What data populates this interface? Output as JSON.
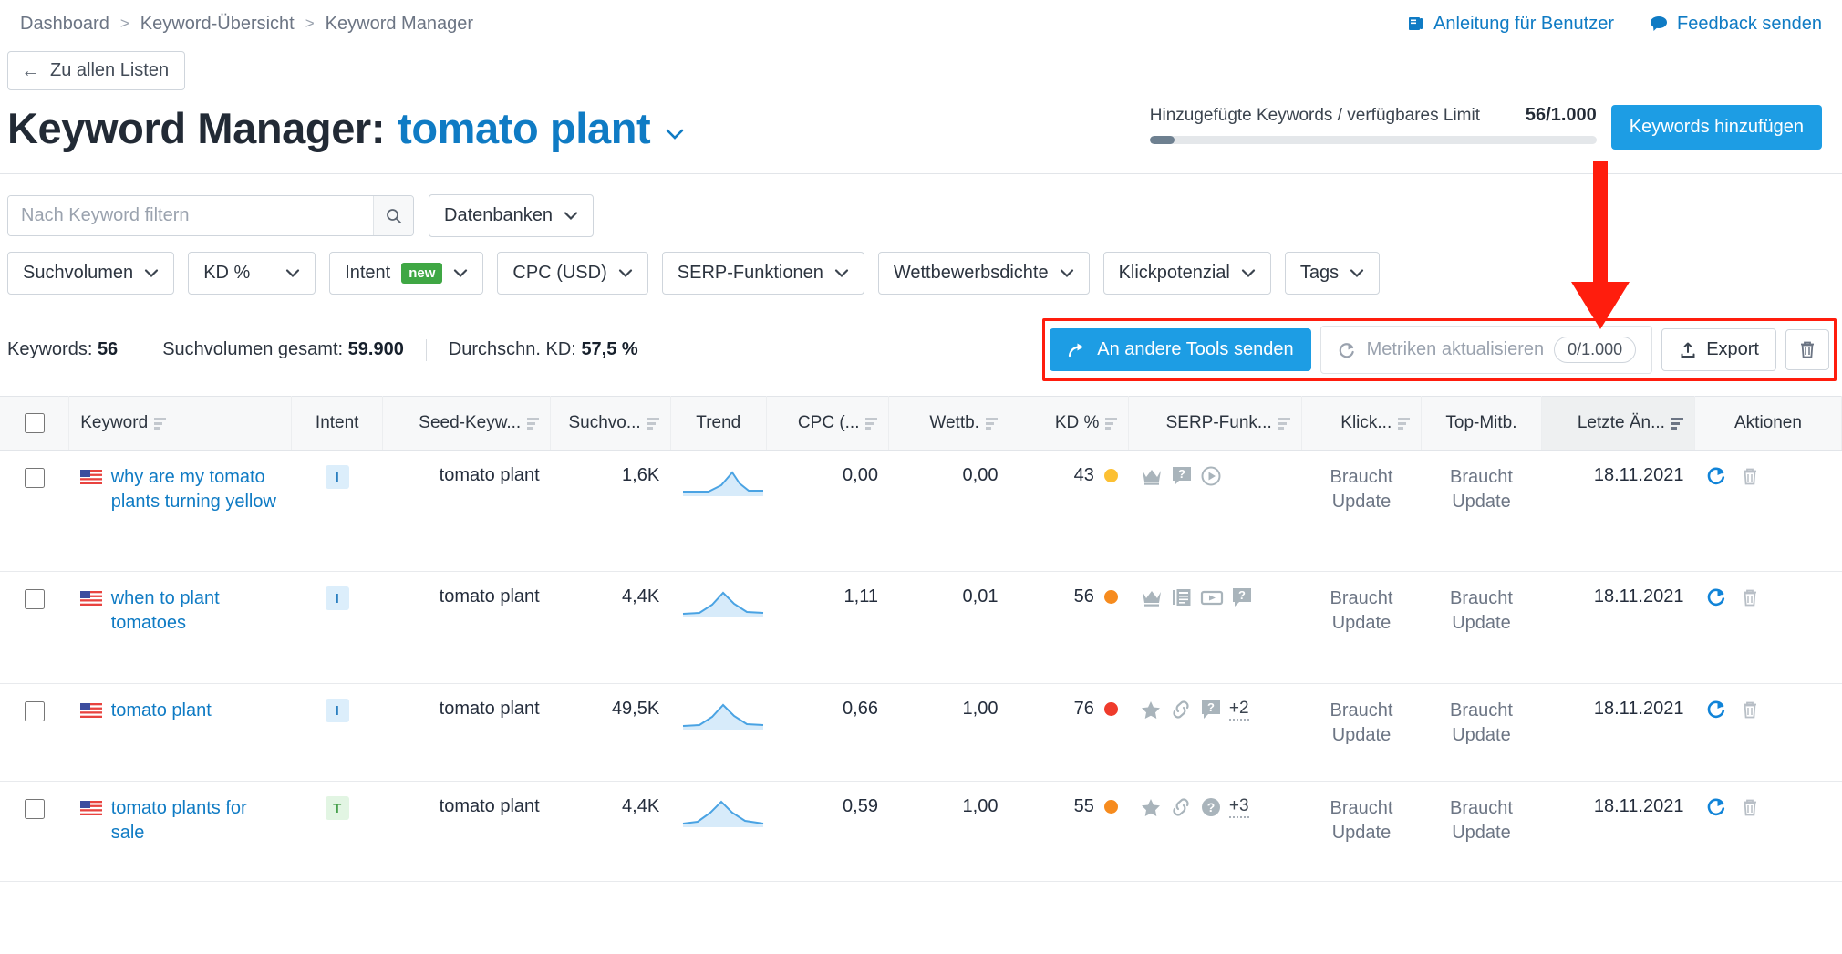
{
  "breadcrumb": {
    "items": [
      "Dashboard",
      "Keyword-Übersicht",
      "Keyword Manager"
    ],
    "separator": ">"
  },
  "toplinks": [
    {
      "label": "Anleitung für Benutzer",
      "icon": "book-icon"
    },
    {
      "label": "Feedback senden",
      "icon": "comment-icon"
    }
  ],
  "back_button": {
    "label": "Zu allen Listen",
    "icon": "arrow-left-icon"
  },
  "header": {
    "title_prefix": "Keyword Manager:",
    "keyword": "tomato plant",
    "caret": "⌄"
  },
  "limit": {
    "label": "Hinzugefügte Keywords / verfügbares Limit",
    "value": "56/1.000",
    "percent": 5.6,
    "add_button": "Keywords hinzufügen"
  },
  "filters": {
    "search": {
      "placeholder": "Nach Keyword filtern",
      "value": ""
    },
    "row1": [
      {
        "label": "Datenbanken"
      }
    ],
    "row2": [
      {
        "label": "Suchvolumen"
      },
      {
        "label": "KD %"
      },
      {
        "label": "Intent",
        "badge": "new"
      },
      {
        "label": "CPC (USD)"
      },
      {
        "label": "SERP-Funktionen"
      },
      {
        "label": "Wettbewerbsdichte"
      },
      {
        "label": "Klickpotenzial"
      },
      {
        "label": "Tags"
      }
    ]
  },
  "stats": [
    {
      "label": "Keywords:",
      "value": "56"
    },
    {
      "label": "Suchvolumen gesamt:",
      "value": "59.900"
    },
    {
      "label": "Durchschn. KD:",
      "value": "57,5 %"
    }
  ],
  "actions": {
    "send_to_tools": "An andere Tools senden",
    "update_metrics": "Metriken aktualisieren",
    "update_metrics_counter": "0/1.000",
    "export": "Export",
    "delete_title": "Löschen"
  },
  "annotation": {
    "type": "red-arrow",
    "color": "#ff1d0d"
  },
  "table": {
    "columns": [
      {
        "key": "checkbox",
        "label": "",
        "sortable": false,
        "align": "center"
      },
      {
        "key": "keyword",
        "label": "Keyword",
        "sortable": true,
        "align": "left"
      },
      {
        "key": "intent",
        "label": "Intent",
        "sortable": false,
        "align": "center"
      },
      {
        "key": "seed",
        "label": "Seed-Keyw...",
        "sortable": true,
        "align": "right"
      },
      {
        "key": "volume",
        "label": "Suchvo...",
        "sortable": true,
        "align": "right"
      },
      {
        "key": "trend",
        "label": "Trend",
        "sortable": false,
        "align": "center"
      },
      {
        "key": "cpc",
        "label": "CPC (...",
        "sortable": true,
        "align": "right"
      },
      {
        "key": "comp",
        "label": "Wettb.",
        "sortable": true,
        "align": "right"
      },
      {
        "key": "kd",
        "label": "KD %",
        "sortable": true,
        "align": "right"
      },
      {
        "key": "serp",
        "label": "SERP-Funk...",
        "sortable": true,
        "align": "right"
      },
      {
        "key": "click",
        "label": "Klick...",
        "sortable": true,
        "align": "right"
      },
      {
        "key": "topcomp",
        "label": "Top-Mitb.",
        "sortable": false,
        "align": "center"
      },
      {
        "key": "updated",
        "label": "Letzte Än...",
        "sortable": true,
        "align": "right",
        "sorted": true
      },
      {
        "key": "actions",
        "label": "Aktionen",
        "sortable": false,
        "align": "center"
      }
    ],
    "rows": [
      {
        "checked": false,
        "flag": "us-flag-icon",
        "keyword": "why are my tomato plants turning yellow",
        "intent": "I",
        "seed": "tomato plant",
        "volume": "1,6K",
        "trend": "late-peak",
        "cpc": "0,00",
        "comp": "0,00",
        "kd": "43",
        "kd_color": "#fcc033",
        "serp_icons": [
          "crown-icon",
          "faq-icon",
          "video-circle-icon"
        ],
        "serp_more": "",
        "click": "Braucht Update",
        "topcomp": "Braucht Update",
        "updated": "18.11.2021"
      },
      {
        "checked": false,
        "flag": "us-flag-icon",
        "keyword": "when to plant tomatoes",
        "intent": "I",
        "seed": "tomato plant",
        "volume": "4,4K",
        "trend": "mid-peak",
        "cpc": "1,11",
        "comp": "0,01",
        "kd": "56",
        "kd_color": "#f68b1e",
        "serp_icons": [
          "crown-icon",
          "news-icon",
          "video-box-icon",
          "faq-icon"
        ],
        "serp_more": "",
        "click": "Braucht Update",
        "topcomp": "Braucht Update",
        "updated": "18.11.2021"
      },
      {
        "checked": false,
        "flag": "us-flag-icon",
        "keyword": "tomato plant",
        "intent": "I",
        "seed": "tomato plant",
        "volume": "49,5K",
        "trend": "mid-peak",
        "cpc": "0,66",
        "comp": "1,00",
        "kd": "76",
        "kd_color": "#ef3b2c",
        "serp_icons": [
          "star-icon",
          "link-icon",
          "faq-icon"
        ],
        "serp_more": "+2",
        "click": "Braucht Update",
        "topcomp": "Braucht Update",
        "updated": "18.11.2021"
      },
      {
        "checked": false,
        "flag": "us-flag-icon",
        "keyword": "tomato plants for sale",
        "intent": "T",
        "seed": "tomato plant",
        "volume": "4,4K",
        "trend": "mid-peak",
        "cpc": "0,59",
        "comp": "1,00",
        "kd": "55",
        "kd_color": "#f68b1e",
        "serp_icons": [
          "star-icon",
          "link-icon",
          "question-circle-icon"
        ],
        "serp_more": "+3",
        "click": "Braucht Update",
        "topcomp": "Braucht Update",
        "updated": "18.11.2021"
      }
    ]
  },
  "colors": {
    "accent": "#1d9de4",
    "link": "#0f7bc4",
    "annotation": "#ff1d0d"
  }
}
